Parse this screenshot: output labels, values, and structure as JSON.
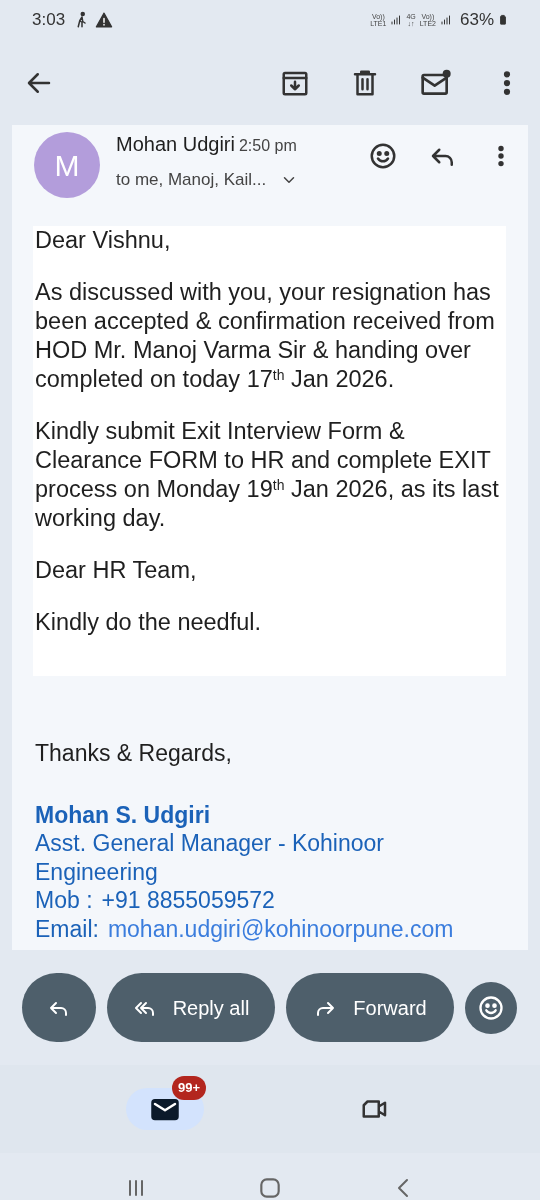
{
  "status_bar": {
    "time": "3:03",
    "signals": [
      {
        "top": "Vo))",
        "bottom": "LTE1"
      },
      {
        "top": "4G",
        "bottom": "↓↑"
      },
      {
        "top": "Vo))",
        "bottom": "LTE2"
      }
    ],
    "battery": "63%"
  },
  "message": {
    "avatar_letter": "M",
    "sender": "Mohan Udgiri",
    "time": "2:50 pm",
    "recipients": "to me, Manoj, Kail..."
  },
  "body": [
    "Dear Vishnu,",
    "As discussed with you, your resignation has been accepted & confirmation received from HOD Mr. Manoj Varma Sir & handing over completed on today 17$^{th}$ Jan 2026.",
    "Kindly submit Exit Interview Form & Clearance FORM to HR and complete EXIT process on Monday  19$^{th}$ Jan 2026, as its last working day.",
    "Dear HR Team,",
    "Kindly do the needful."
  ],
  "signature": {
    "closing": "Thanks & Regards,",
    "name": "Mohan S. Udgiri",
    "title": "Asst. General Manager - Kohinoor Engineering",
    "phone_label": "Mob :",
    "phone": "+91 8855059572",
    "email_label": "Email:",
    "email": "mohan.udgiri@kohinoorpune.com"
  },
  "actions": [
    {
      "kind": "reply"
    },
    {
      "kind": "reply_all",
      "label": "Reply all"
    },
    {
      "kind": "forward",
      "label": "Forward"
    },
    {
      "kind": "react"
    }
  ],
  "bottom_nav": [
    {
      "kind": "mail",
      "selected": true,
      "badge": "99+"
    },
    {
      "kind": "video",
      "selected": false
    }
  ]
}
